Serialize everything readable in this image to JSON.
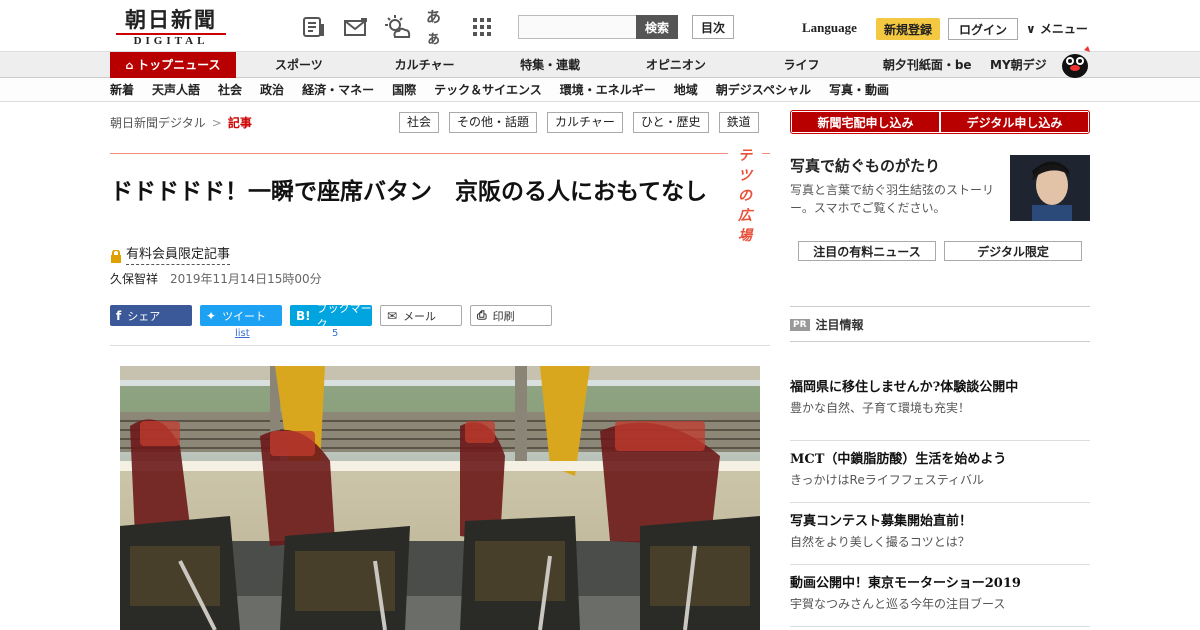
{
  "header": {
    "logo_kanji": "朝日新聞",
    "logo_sub": "DIGITAL",
    "icons": [
      "news-icon",
      "mail-icon",
      "weather-icon",
      "font-size-icon",
      "grid-icon"
    ],
    "font_icon_text": "あぁ",
    "search_button": "検索",
    "toc_button": "目次",
    "language": "Language",
    "register": "新規登録",
    "login": "ログイン",
    "menu": "∨ メニュー"
  },
  "nav_primary": [
    "トップニュース",
    "スポーツ",
    "カルチャー",
    "特集・連載",
    "オピニオン",
    "ライフ",
    "朝夕刊紙面・be",
    "MY朝デジ"
  ],
  "nav_secondary": [
    "新着",
    "天声人語",
    "社会",
    "政治",
    "経済・マネー",
    "国際",
    "テック＆サイエンス",
    "環境・エネルギー",
    "地域",
    "朝デジスペシャル",
    "写真・動画"
  ],
  "breadcrumb": {
    "home": "朝日新聞デジタル",
    "sep": ">",
    "current": "記事"
  },
  "tags": [
    "社会",
    "その他・話題",
    "カルチャー",
    "ひと・歴史",
    "鉄道"
  ],
  "corner": "テツの広場",
  "article": {
    "title": "ドドドドド！一瞬で座席バタン　京阪のる人におもてなし",
    "paid_label": "有料会員限定記事",
    "author": "久保智祥",
    "date": "2019年11月14日15時00分"
  },
  "share": {
    "facebook": "シェア",
    "twitter": "ツイート",
    "hatena": "ブックマーク",
    "mail": "メール",
    "print": "印刷",
    "tweet_count": "list",
    "bookmark_count": "5"
  },
  "sidebar": {
    "subscribe_paper": "新聞宅配申し込み",
    "subscribe_digital": "デジタル申し込み",
    "feature_title": "写真で紡ぐものがたり",
    "feature_desc": "写真と言葉で紡ぐ羽生結弦のストーリー。スマホでご覧ください。",
    "tab1": "注目の有料ニュース",
    "tab2": "デジタル限定",
    "pr_badge": "PR",
    "pr_heading": "注目情報",
    "pr_items": [
      {
        "title": "福岡県に移住しませんか?体験談公開中",
        "desc": "豊かな自然、子育て環境も充実！"
      },
      {
        "title": "MCT（中鎖脂肪酸）生活を始めよう",
        "desc": "きっかけはReライフフェスティバル"
      },
      {
        "title": "写真コンテスト募集開始直前！",
        "desc": "自然をより美しく撮るコツとは？"
      },
      {
        "title": "動画公開中！東京モーターショー2019",
        "desc": "宇賀なつみさんと巡る今年の注目ブース"
      }
    ]
  },
  "colors": {
    "brand_red": "#b80000",
    "accent_yellow": "#f5c842",
    "corner_orange": "#e8503a"
  }
}
